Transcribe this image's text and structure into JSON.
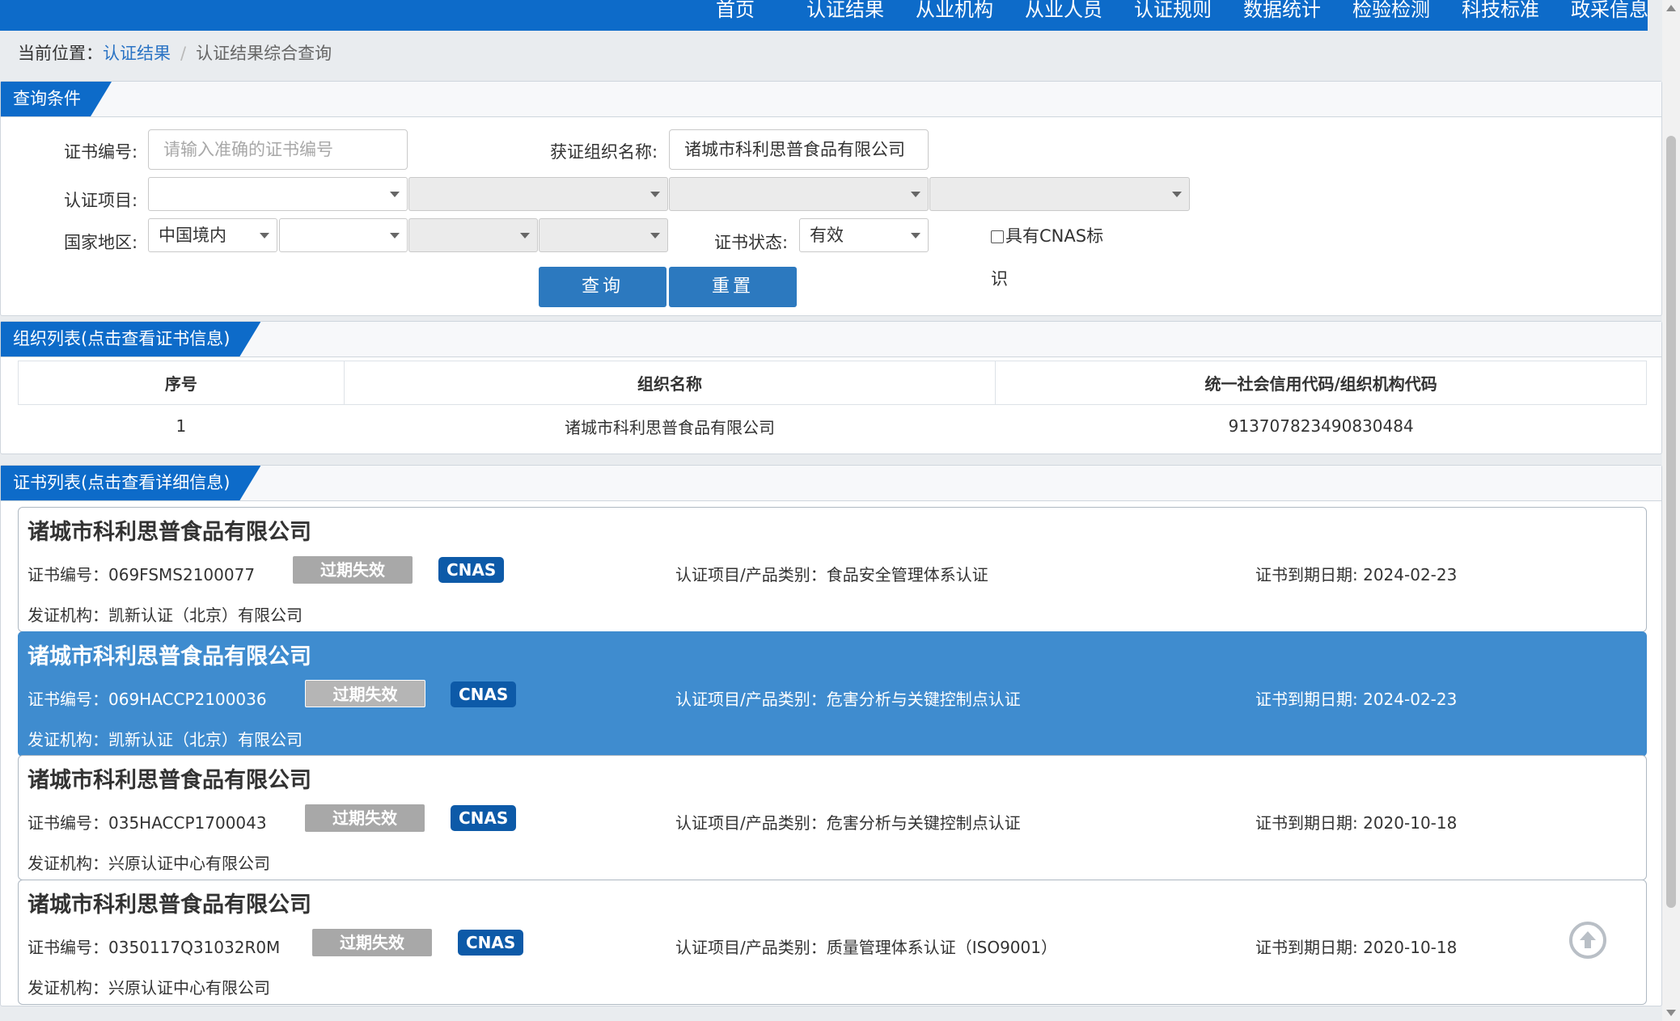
{
  "nav": {
    "items": [
      "首页",
      "认证结果",
      "从业机构",
      "从业人员",
      "认证规则",
      "数据统计",
      "检验检测",
      "科技标准",
      "政采信息"
    ]
  },
  "breadcrumb": {
    "prefix": "当前位置：",
    "link": "认证结果",
    "separator": "/",
    "current": "认证结果综合查询"
  },
  "query": {
    "title": "查询条件",
    "cert_no_label": "证书编号:",
    "cert_no_placeholder": "请输入准确的证书编号",
    "org_label": "获证组织名称:",
    "org_value": "诸城市科利思普食品有限公司",
    "project_label": "认证项目:",
    "region_label": "国家地区:",
    "region_value": "中国境内",
    "status_label": "证书状态:",
    "status_value": "有效",
    "cnas_label": "具有CNAS标识",
    "search_button": "查询",
    "reset_button": "重置"
  },
  "orgs": {
    "title": "组织列表(点击查看证书信息)",
    "columns": [
      "序号",
      "组织名称",
      "统一社会信用代码/组织机构代码"
    ],
    "rows": [
      [
        "1",
        "诸城市科利思普食品有限公司",
        "913707823490830484"
      ]
    ]
  },
  "certs": {
    "title": "证书列表(点击查看详细信息)",
    "cert_no_prefix": "证书编号：",
    "project_prefix": "认证项目/产品类别：",
    "expiry_prefix": "证书到期日期: ",
    "issuer_prefix": "发证机构：",
    "status_badge": "过期失效",
    "cnas_badge": "CNAS",
    "items": [
      {
        "org": "诸城市科利思普食品有限公司",
        "cert_no": "069FSMS2100077",
        "project": "食品安全管理体系认证",
        "expiry": "2024-02-23",
        "issuer": "凯新认证（北京）有限公司",
        "highlight": false
      },
      {
        "org": "诸城市科利思普食品有限公司",
        "cert_no": "069HACCP2100036",
        "project": "危害分析与关键控制点认证",
        "expiry": "2024-02-23",
        "issuer": "凯新认证（北京）有限公司",
        "highlight": true
      },
      {
        "org": "诸城市科利思普食品有限公司",
        "cert_no": "035HACCP1700043",
        "project": "危害分析与关键控制点认证",
        "expiry": "2020-10-18",
        "issuer": "兴原认证中心有限公司",
        "highlight": false
      },
      {
        "org": "诸城市科利思普食品有限公司",
        "cert_no": "0350117Q31032R0M",
        "project": "质量管理体系认证（ISO9001）",
        "expiry": "2020-10-18",
        "issuer": "兴原认证中心有限公司",
        "highlight": false
      }
    ]
  },
  "colors": {
    "primary": "#0d6bc9",
    "button": "#2c79bf",
    "highlight_row": "#3f8ccf",
    "badge_expired": "#a8a8a8",
    "badge_cnas": "#0d5aa8"
  },
  "icons": {
    "back_to_top": "arrow-up-circle-icon"
  }
}
